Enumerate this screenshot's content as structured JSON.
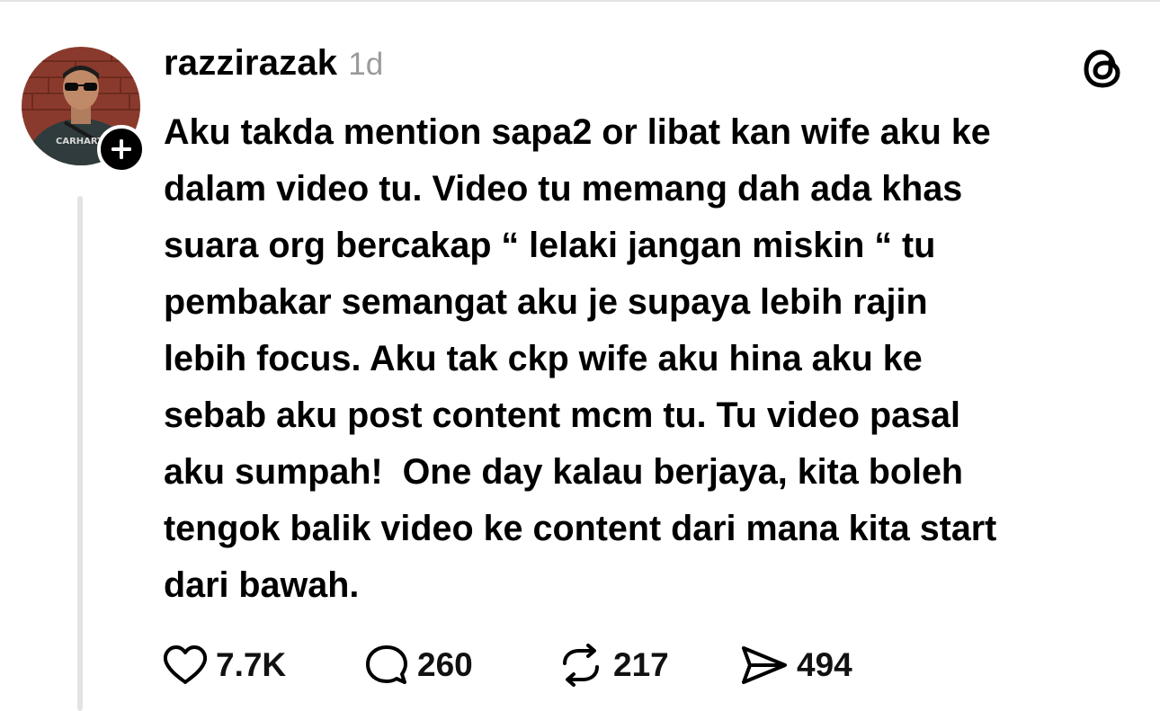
{
  "post": {
    "username": "razzirazak",
    "timestamp": "1d",
    "body_lines": [
      "Aku takda mention sapa2 or libat kan wife aku ke",
      "dalam video tu. Video tu memang dah ada khas",
      "suara org bercakap “ lelaki jangan miskin “ tu",
      "pembakar semangat aku je supaya lebih rajin",
      "lebih focus. Aku tak ckp wife aku hina aku ke",
      "sebab aku post content mcm tu. Tu video pasal",
      "aku sumpah!  One day kalau berjaya, kita boleh",
      "tengok balik video ke content dari mana kita start",
      "dari bawah."
    ]
  },
  "actions": {
    "like_count": "7.7K",
    "reply_count": "260",
    "repost_count": "217",
    "share_count": "494"
  },
  "icons": {
    "avatar": "profile-photo",
    "follow": "plus-icon",
    "app_logo": "threads-logo-icon",
    "like": "heart-icon",
    "reply": "speech-bubble-icon",
    "repost": "repost-arrows-icon",
    "share": "paper-plane-icon"
  },
  "colors": {
    "text": "#000000",
    "timestamp": "#9a9a9a",
    "thread_line": "#e3e3e3",
    "badge": "#000000"
  }
}
